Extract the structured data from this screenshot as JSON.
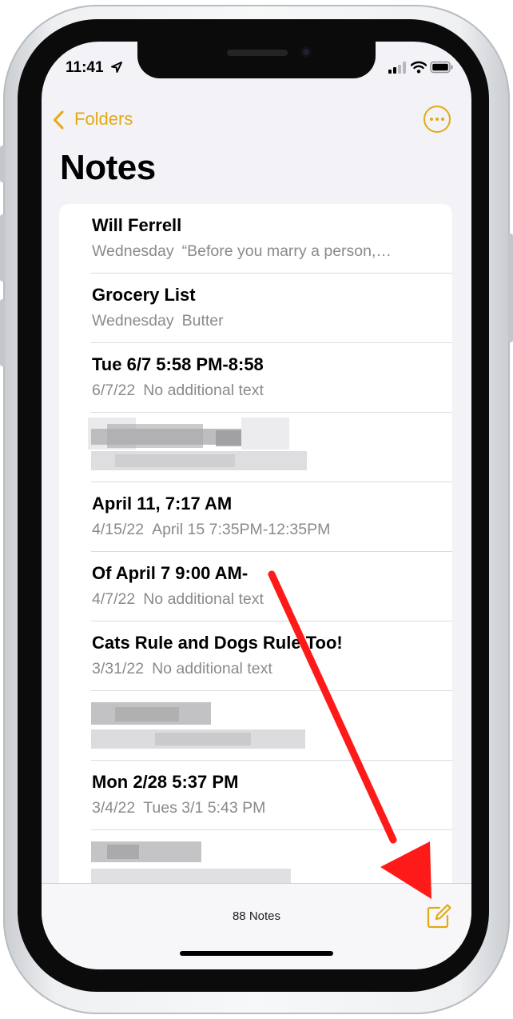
{
  "status_bar": {
    "time": "11:41"
  },
  "nav": {
    "back_label": "Folders"
  },
  "page_title": "Notes",
  "notes": [
    {
      "title": "Will Ferrell",
      "date": "Wednesday",
      "preview": "“Before you marry a person,…"
    },
    {
      "title": "Grocery List",
      "date": "Wednesday",
      "preview": "Butter"
    },
    {
      "title": "Tue 6/7 5:58 PM-8:58",
      "date": "6/7/22",
      "preview": "No additional text"
    },
    {
      "title": "April 11, 7:17 AM",
      "date": "4/15/22",
      "preview": "April 15 7:35PM-12:35PM"
    },
    {
      "title": "Of April 7 9:00 AM-",
      "date": "4/7/22",
      "preview": "No additional text"
    },
    {
      "title": "Cats Rule and Dogs Rule Too!",
      "date": "3/31/22",
      "preview": "No additional text"
    },
    {
      "title": "Mon 2/28 5:37 PM",
      "date": "3/4/22",
      "preview": "Tues 3/1 5:43 PM"
    }
  ],
  "toolbar": {
    "note_count": "88 Notes"
  },
  "colors": {
    "accent": "#e3aa12",
    "arrow": "#ff1a1a",
    "secondary_text": "#8a8a8e"
  },
  "icons": {
    "back": "chevron-left-icon",
    "more": "ellipsis-circle-icon",
    "compose": "compose-icon",
    "location": "location-arrow-icon"
  }
}
